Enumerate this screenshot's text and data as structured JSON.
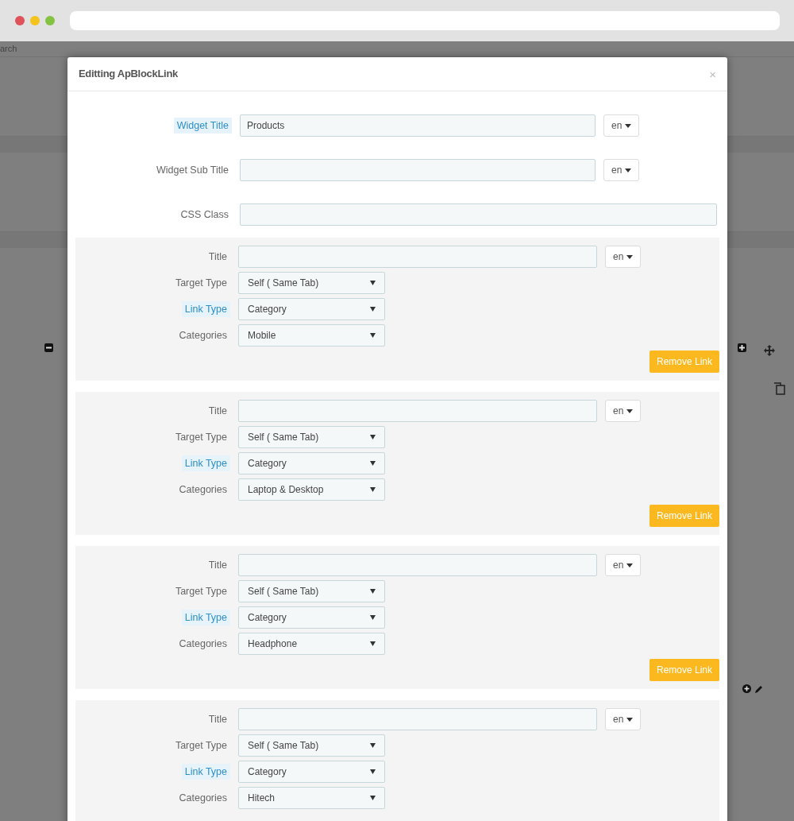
{
  "background": {
    "search_text": "arch"
  },
  "modal": {
    "title": "Editting ApBlockLink",
    "close": "×",
    "fields": [
      {
        "label": "Widget Title",
        "highlighted": true,
        "value": "Products",
        "lang": "en"
      },
      {
        "label": "Widget Sub Title",
        "highlighted": false,
        "lang": "en"
      },
      {
        "label": "CSS Class",
        "highlighted": false
      }
    ],
    "links": [
      {
        "title_label": "Title",
        "lang": "en",
        "rows": [
          {
            "label": "Target Type",
            "highlighted": false,
            "value": "Self ( Same Tab)"
          },
          {
            "label": "Link Type",
            "highlighted": true,
            "value": "Category"
          },
          {
            "label": "Categories",
            "highlighted": false,
            "value": "Mobile"
          }
        ],
        "remove_button": "Remove Link"
      },
      {
        "title_label": "Title",
        "lang": "en",
        "rows": [
          {
            "label": "Target Type",
            "highlighted": false,
            "value": "Self ( Same Tab)"
          },
          {
            "label": "Link Type",
            "highlighted": true,
            "value": "Category"
          },
          {
            "label": "Categories",
            "highlighted": false,
            "value": "Laptop & Desktop"
          }
        ],
        "remove_button": "Remove Link"
      },
      {
        "title_label": "Title",
        "lang": "en",
        "rows": [
          {
            "label": "Target Type",
            "highlighted": false,
            "value": "Self ( Same Tab)"
          },
          {
            "label": "Link Type",
            "highlighted": true,
            "value": "Category"
          },
          {
            "label": "Categories",
            "highlighted": false,
            "value": "Headphone"
          }
        ],
        "remove_button": "Remove Link"
      },
      {
        "title_label": "Title",
        "lang": "en",
        "rows": [
          {
            "label": "Target Type",
            "highlighted": false,
            "value": "Self ( Same Tab)"
          },
          {
            "label": "Link Type",
            "highlighted": true,
            "value": "Category"
          },
          {
            "label": "Categories",
            "highlighted": false,
            "value": "Hitech"
          }
        ]
      }
    ]
  }
}
